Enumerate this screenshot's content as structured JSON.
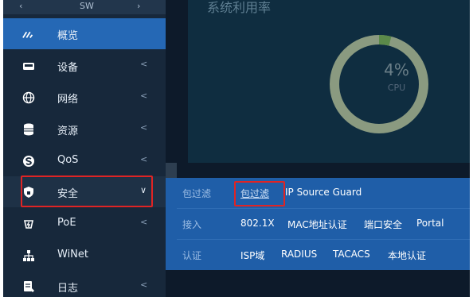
{
  "sidebar": {
    "device_label": "SW",
    "prev_icon": "chevron-left-icon",
    "next_icon": "chevron-right-icon",
    "items": [
      {
        "label": "概览",
        "icon": "dashboard-gauge-icon",
        "active": true
      },
      {
        "label": "设备",
        "icon": "device-icon",
        "expandable": true
      },
      {
        "label": "网络",
        "icon": "globe-icon",
        "expandable": true
      },
      {
        "label": "资源",
        "icon": "database-icon",
        "expandable": true
      },
      {
        "label": "QoS",
        "icon": "qos-icon",
        "expandable": true
      },
      {
        "label": "安全",
        "icon": "shield-icon",
        "expandable": true,
        "expanded": true
      },
      {
        "label": "PoE",
        "icon": "poe-icon",
        "expandable": true
      },
      {
        "label": "WiNet",
        "icon": "network-topology-icon"
      },
      {
        "label": "日志",
        "icon": "log-icon",
        "expandable": true
      }
    ]
  },
  "main": {
    "panel_title": "系统利用率",
    "gauge": {
      "value": "4%",
      "label": "CPU",
      "fraction": 0.04
    }
  },
  "submenu": {
    "rows": [
      {
        "label": "包过滤",
        "options": [
          "包过滤",
          "IP Source Guard"
        ]
      },
      {
        "label": "接入",
        "options": [
          "802.1X",
          "MAC地址认证",
          "端口安全",
          "Portal"
        ]
      },
      {
        "label": "认证",
        "options": [
          "ISP域",
          "RADIUS",
          "TACACS",
          "本地认证"
        ]
      }
    ]
  },
  "colors": {
    "sidebar_bg": "#17283b",
    "active_item": "#2568b5",
    "submenu_bg": "#1f5ea8",
    "highlight_box": "#e02424",
    "gauge_ring": "#8a9a80",
    "gauge_progress": "#5b8a4a"
  }
}
